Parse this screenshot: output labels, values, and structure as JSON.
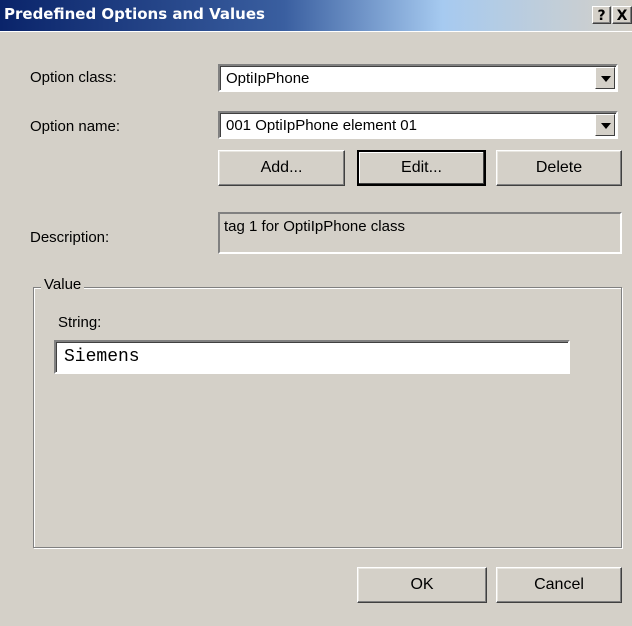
{
  "window": {
    "title": "Predefined Options and Values",
    "help_label": "?",
    "close_label": "X"
  },
  "form": {
    "option_class_label": "Option class:",
    "option_class_value": "OptiIpPhone",
    "option_name_label": "Option name:",
    "option_name_value": "001 OptiIpPhone element 01",
    "add_label": "Add...",
    "edit_label": "Edit...",
    "delete_label": "Delete",
    "description_label": "Description:",
    "description_value": "tag 1 for OptiIpPhone class"
  },
  "value_group": {
    "legend": "Value",
    "string_label": "String:",
    "string_value": "Siemens"
  },
  "footer": {
    "ok_label": "OK",
    "cancel_label": "Cancel"
  }
}
